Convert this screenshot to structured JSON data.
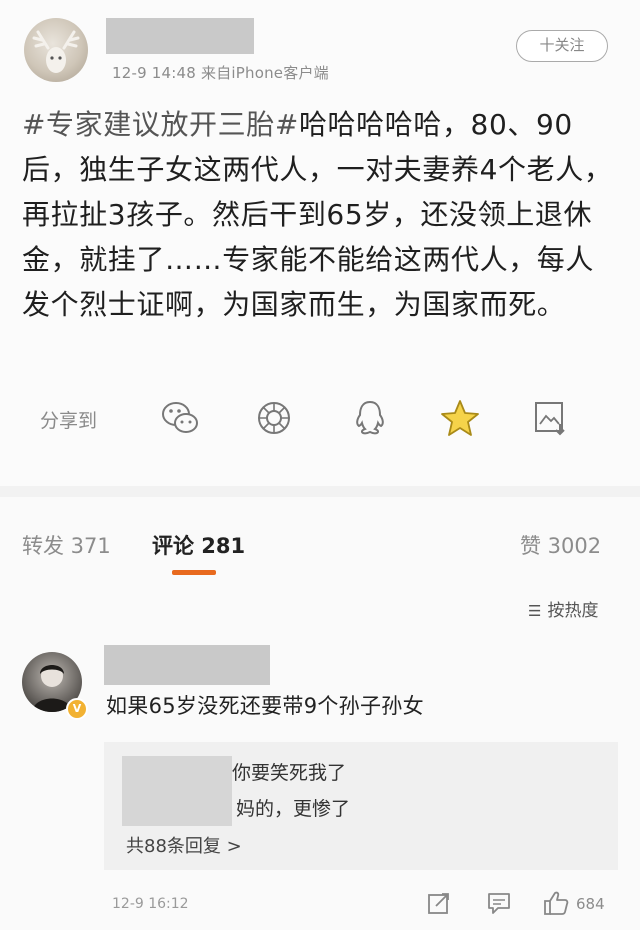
{
  "post": {
    "follow_label": "十关注",
    "meta": "12-9 14:48  来自iPhone客户端",
    "hashtag": "#专家建议放开三胎#",
    "body": "哈哈哈哈哈，80、90后，独生子女这两代人，一对夫妻养4个老人，再拉扯3孩子。然后干到65岁，还没领上退休金，就挂了……专家能不能给这两代人，每人发个烈士证啊，为国家而生，为国家而死。",
    "share_label": "分享到",
    "share_icons": [
      "wechat-icon",
      "moments-icon",
      "qq-icon",
      "qzone-star-icon",
      "save-image-icon"
    ]
  },
  "tabs": {
    "forward": "转发 371",
    "comment": "评论 281",
    "like": "赞 3002",
    "accent": "#e8691e"
  },
  "sort": {
    "label": "按热度",
    "icon": "sort-icon"
  },
  "comment": {
    "text": "如果65岁没死还要带9个孙子孙女",
    "reply_1": "你要笑死我了",
    "reply_2": "妈的，更惨了",
    "more_replies": "共88条回复 >",
    "time": "12-9 16:12",
    "like_count": "684"
  }
}
